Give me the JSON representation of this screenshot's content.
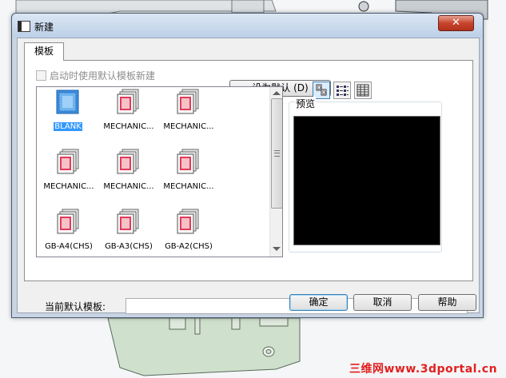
{
  "window": {
    "title": "新建",
    "close_symbol": "✕"
  },
  "tabs": [
    {
      "label": "模板"
    }
  ],
  "startup_checkbox": {
    "label": "启动时使用默认模板新建",
    "checked": false,
    "enabled": false
  },
  "set_default_button": "设为默认 (D)",
  "templates": [
    {
      "label": "BLANK",
      "selected": true,
      "icon": "blank-template-icon"
    },
    {
      "label": "MECHANIC...",
      "selected": false,
      "icon": "template-doc-icon"
    },
    {
      "label": "MECHANIC...",
      "selected": false,
      "icon": "template-doc-icon"
    },
    {
      "label": "MECHANIC...",
      "selected": false,
      "icon": "template-doc-icon"
    },
    {
      "label": "MECHANIC...",
      "selected": false,
      "icon": "template-doc-icon"
    },
    {
      "label": "MECHANIC...",
      "selected": false,
      "icon": "template-doc-icon"
    },
    {
      "label": "GB-A4(CHS)",
      "selected": false,
      "icon": "template-doc-icon"
    },
    {
      "label": "GB-A3(CHS)",
      "selected": false,
      "icon": "template-doc-icon"
    },
    {
      "label": "GB-A2(CHS)",
      "selected": false,
      "icon": "template-doc-icon"
    }
  ],
  "view_buttons": [
    {
      "icon": "large-icons-view-icon",
      "active": true
    },
    {
      "icon": "list-view-icon",
      "active": false
    },
    {
      "icon": "details-view-icon",
      "active": false
    }
  ],
  "preview": {
    "label": "预览"
  },
  "current_default": {
    "label": "当前默认模板:",
    "value": ""
  },
  "buttons": {
    "ok": "确定",
    "cancel": "取消",
    "help": "帮助"
  },
  "watermark": "三维网www.3dportal.cn",
  "colors": {
    "selection": "#3399ff",
    "close_button": "#c7442c",
    "watermark": "#e2201f"
  }
}
